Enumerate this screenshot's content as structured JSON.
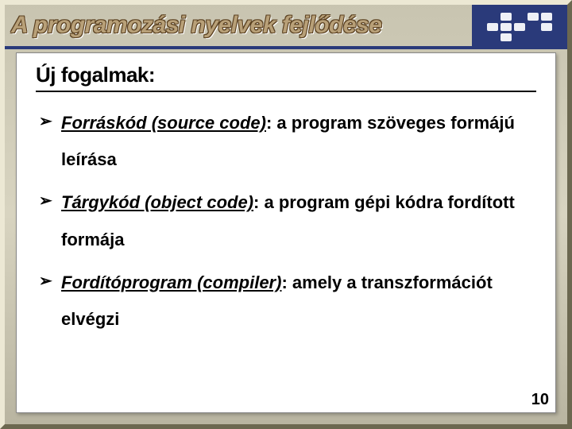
{
  "header": {
    "title": "A programozási nyelvek fejlődése"
  },
  "content": {
    "subtitle": "Új fogalmak:",
    "bullets": [
      {
        "term": "Forráskód (source code)",
        "rest": ": a program szöveges formájú leírása"
      },
      {
        "term": "Tárgykód (object code)",
        "rest": ": a program gépi kódra fordított formája"
      },
      {
        "term": "Fordítóprogram (compiler)",
        "rest": ": amely a transzformációt elvégzi"
      }
    ]
  },
  "page_number": "10"
}
